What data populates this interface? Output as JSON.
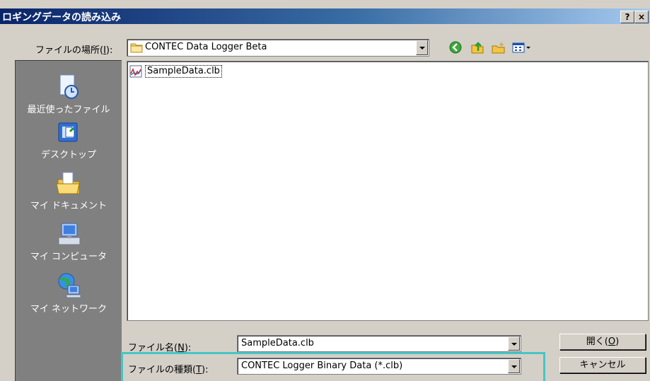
{
  "window": {
    "title": "ロギングデータの読み込み",
    "help_label": "?",
    "close_label": "×"
  },
  "lookin": {
    "label_prefix": "ファイルの場所(",
    "label_key": "I",
    "label_suffix": "):",
    "value": "CONTEC Data Logger Beta"
  },
  "toolbar": {
    "icons": [
      "back-icon",
      "up-folder-icon",
      "new-folder-icon",
      "view-menu-icon"
    ]
  },
  "places": [
    {
      "label": "最近使ったファイル",
      "icon": "recent-icon"
    },
    {
      "label": "デスクトップ",
      "icon": "desktop-icon"
    },
    {
      "label": "マイ ドキュメント",
      "icon": "my-documents-icon"
    },
    {
      "label": "マイ コンピュータ",
      "icon": "my-computer-icon"
    },
    {
      "label": "マイ ネットワーク",
      "icon": "my-network-icon"
    }
  ],
  "files": [
    {
      "name": "SampleData.clb",
      "icon": "clb-file-icon"
    }
  ],
  "filename": {
    "label_prefix": "ファイル名(",
    "label_key": "N",
    "label_suffix": "):",
    "value": "SampleData.clb"
  },
  "filetype": {
    "label_prefix": "ファイルの種類(",
    "label_key": "T",
    "label_suffix": "):",
    "value": "CONTEC Logger Binary Data (*.clb)"
  },
  "buttons": {
    "open": {
      "prefix": "開く(",
      "key": "O",
      "suffix": ")"
    },
    "cancel": "キャンセル"
  },
  "colors": {
    "title_gradient_start": "#0a246a",
    "title_gradient_end": "#a6caf0",
    "highlight": "#46c6c4",
    "dialog_face": "#d4d0c8",
    "places_bar": "#808080"
  }
}
